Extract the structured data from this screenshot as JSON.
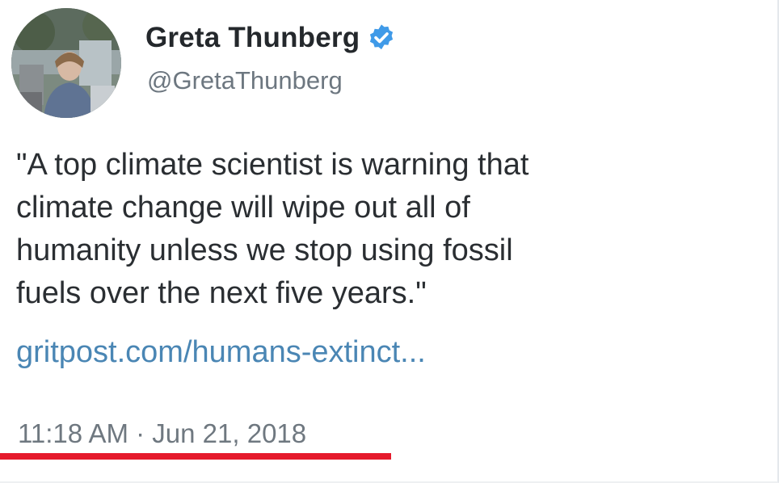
{
  "tweet": {
    "display_name": "Greta Thunberg",
    "handle": "@GretaThunberg",
    "verified": true,
    "text_lines": [
      "\"A top climate scientist is warning that",
      "climate change will wipe out all of",
      "humanity unless we stop using fossil",
      "fuels over the next five years.\""
    ],
    "link_text": "gritpost.com/humans-extinct...",
    "timestamp": "11:18 AM · Jun 21, 2018"
  },
  "icons": {
    "verified": "verified-badge-icon",
    "avatar": "profile-avatar"
  },
  "colors": {
    "link": "#4a86b4",
    "verified_badge": "#3f9ae8",
    "highlight_underline": "#e51a2c",
    "secondary_text": "#6d7780"
  }
}
